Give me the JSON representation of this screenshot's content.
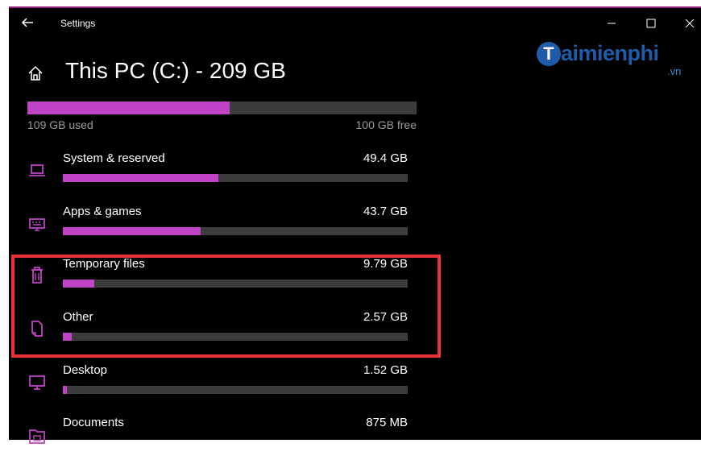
{
  "window": {
    "title": "Settings"
  },
  "logo": {
    "badge_letter": "T",
    "text": "aimienphi",
    "tld": ".vn"
  },
  "page": {
    "title": "This PC (C:) - 209 GB"
  },
  "storage": {
    "used_label": "109 GB used",
    "free_label": "100 GB free",
    "used_fraction": 0.52
  },
  "categories": [
    {
      "name": "System & reserved",
      "size": "49.4 GB",
      "fraction": 0.45,
      "icon": "laptop-icon"
    },
    {
      "name": "Apps & games",
      "size": "43.7 GB",
      "fraction": 0.4,
      "icon": "keyboard-icon"
    },
    {
      "name": "Temporary files",
      "size": "9.79 GB",
      "fraction": 0.09,
      "icon": "trash-icon"
    },
    {
      "name": "Other",
      "size": "2.57 GB",
      "fraction": 0.025,
      "icon": "file-icon"
    },
    {
      "name": "Desktop",
      "size": "1.52 GB",
      "fraction": 0.012,
      "icon": "monitor-icon"
    },
    {
      "name": "Documents",
      "size": "875 MB",
      "fraction": 0.008,
      "icon": "folder-icon"
    }
  ],
  "colors": {
    "accent": "#c043c6",
    "highlight": "#e8323a",
    "background": "#000000",
    "bar_track": "#3c3c3c"
  }
}
